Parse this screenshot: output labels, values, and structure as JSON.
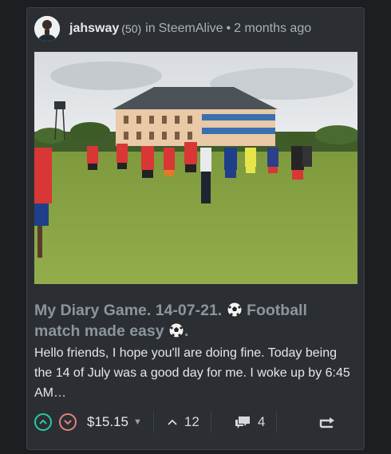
{
  "post": {
    "author": "jahsway",
    "reputation": "(50)",
    "in_word": "in",
    "community": "SteemAlive",
    "separator": "•",
    "time": "2 months ago",
    "title_part1": "My Diary Game. 14-07-21.",
    "title_part2": "Football match made easy",
    "title_end": ".",
    "excerpt": "Hello friends, I hope you'll are doing fine. Today being the 14 of July was a good day for me. I woke up by 6:45 AM…"
  },
  "footer": {
    "payout": "$15.15",
    "votes": "12",
    "comments": "4"
  },
  "colors": {
    "upvote": "#2cc9a3",
    "downvote": "#e0827c",
    "card_bg": "#2b2f33",
    "title": "#8c959d"
  },
  "icons": [
    "avatar",
    "upvote-icon",
    "downvote-icon",
    "dropdown-caret-icon",
    "votes-chevron-icon",
    "comments-icon",
    "resteem-icon",
    "soccer-ball-icon"
  ]
}
